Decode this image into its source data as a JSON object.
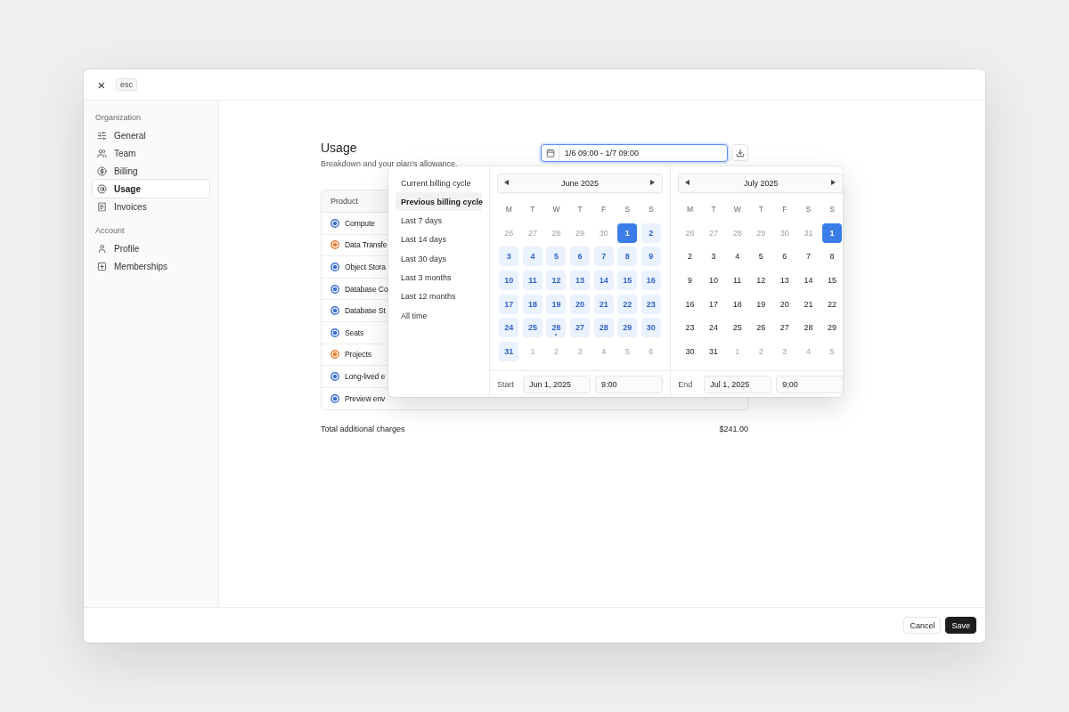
{
  "header": {
    "close": "×",
    "shortcut": "esc"
  },
  "sidebar": {
    "sections": [
      {
        "title": "Organization",
        "items": [
          {
            "label": "General",
            "selected": false
          },
          {
            "label": "Team",
            "selected": false
          },
          {
            "label": "Billing",
            "selected": false
          },
          {
            "label": "Usage",
            "selected": true
          },
          {
            "label": "Invoices",
            "selected": false
          }
        ]
      },
      {
        "title": "Account",
        "items": [
          {
            "label": "Profile",
            "selected": false
          },
          {
            "label": "Memberships",
            "selected": false
          }
        ]
      }
    ]
  },
  "usage": {
    "title": "Usage",
    "subtitle": "Breakdown and your plan’s allowance.",
    "date_range": "1/6 09:00 - 1/7 09:00",
    "table": {
      "columns": [
        "Product"
      ],
      "rows": [
        {
          "product": "Compute",
          "color": "#3b6fd8"
        },
        {
          "product": "Data Transfe",
          "color": "#ee7a2e"
        },
        {
          "product": "Object Stora",
          "color": "#3b6fd8"
        },
        {
          "product": "Database Co",
          "color": "#3b6fd8"
        },
        {
          "product": "Database St",
          "color": "#3b6fd8"
        },
        {
          "product": "Seats",
          "color": "#3b6fd8"
        },
        {
          "product": "Projects",
          "color": "#ee7a2e"
        },
        {
          "product": "Long-lived e",
          "color": "#3b6fd8"
        },
        {
          "product": "Preview env",
          "color": "#3b6fd8"
        }
      ]
    },
    "total": {
      "label": "Total additional charges",
      "value": "$241.00"
    }
  },
  "picker": {
    "presets": [
      {
        "label": "Current billing cycle",
        "selected": false
      },
      {
        "label": "Previous billing cycle",
        "selected": true
      },
      {
        "label": "Last 7 days",
        "selected": false
      },
      {
        "label": "Last 14 days",
        "selected": false
      },
      {
        "label": "Last 30 days",
        "selected": false
      },
      {
        "label": "Last 3 months",
        "selected": false
      },
      {
        "label": "Last 12 months",
        "selected": false
      },
      {
        "label": "All time",
        "selected": false
      }
    ],
    "months": [
      {
        "title": "June 2025",
        "weekdays": [
          "M",
          "T",
          "W",
          "T",
          "F",
          "S",
          "S"
        ],
        "days": [
          {
            "label": "26",
            "kind": "outside"
          },
          {
            "label": "27",
            "kind": "outside"
          },
          {
            "label": "28",
            "kind": "outside"
          },
          {
            "label": "29",
            "kind": "outside"
          },
          {
            "label": "30",
            "kind": "outside"
          },
          {
            "label": "1",
            "kind": "endpoint"
          },
          {
            "label": "2",
            "kind": "range"
          },
          {
            "label": "3",
            "kind": "range"
          },
          {
            "label": "4",
            "kind": "range"
          },
          {
            "label": "5",
            "kind": "range"
          },
          {
            "label": "6",
            "kind": "range"
          },
          {
            "label": "7",
            "kind": "range"
          },
          {
            "label": "8",
            "kind": "range"
          },
          {
            "label": "9",
            "kind": "range"
          },
          {
            "label": "10",
            "kind": "range"
          },
          {
            "label": "11",
            "kind": "range"
          },
          {
            "label": "12",
            "kind": "range"
          },
          {
            "label": "13",
            "kind": "range"
          },
          {
            "label": "14",
            "kind": "range"
          },
          {
            "label": "15",
            "kind": "range"
          },
          {
            "label": "16",
            "kind": "range"
          },
          {
            "label": "17",
            "kind": "range"
          },
          {
            "label": "18",
            "kind": "range"
          },
          {
            "label": "19",
            "kind": "range"
          },
          {
            "label": "20",
            "kind": "range"
          },
          {
            "label": "21",
            "kind": "range"
          },
          {
            "label": "22",
            "kind": "range"
          },
          {
            "label": "23",
            "kind": "range"
          },
          {
            "label": "24",
            "kind": "range"
          },
          {
            "label": "25",
            "kind": "range"
          },
          {
            "label": "26",
            "kind": "range-today"
          },
          {
            "label": "27",
            "kind": "range"
          },
          {
            "label": "28",
            "kind": "range"
          },
          {
            "label": "29",
            "kind": "range"
          },
          {
            "label": "30",
            "kind": "range"
          },
          {
            "label": "31",
            "kind": "range"
          },
          {
            "label": "1",
            "kind": "outside"
          },
          {
            "label": "2",
            "kind": "outside"
          },
          {
            "label": "3",
            "kind": "outside"
          },
          {
            "label": "4",
            "kind": "outside"
          },
          {
            "label": "5",
            "kind": "outside"
          },
          {
            "label": "6",
            "kind": "outside"
          }
        ]
      },
      {
        "title": "July 2025",
        "weekdays": [
          "M",
          "T",
          "W",
          "T",
          "F",
          "S",
          "S"
        ],
        "days": [
          {
            "label": "26",
            "kind": "outside"
          },
          {
            "label": "27",
            "kind": "outside"
          },
          {
            "label": "28",
            "kind": "outside"
          },
          {
            "label": "29",
            "kind": "outside"
          },
          {
            "label": "30",
            "kind": "outside"
          },
          {
            "label": "31",
            "kind": "outside"
          },
          {
            "label": "1",
            "kind": "endpoint"
          },
          {
            "label": "2",
            "kind": "plain"
          },
          {
            "label": "3",
            "kind": "plain"
          },
          {
            "label": "4",
            "kind": "plain"
          },
          {
            "label": "5",
            "kind": "plain"
          },
          {
            "label": "6",
            "kind": "plain"
          },
          {
            "label": "7",
            "kind": "plain"
          },
          {
            "label": "8",
            "kind": "plain"
          },
          {
            "label": "9",
            "kind": "plain"
          },
          {
            "label": "10",
            "kind": "plain"
          },
          {
            "label": "11",
            "kind": "plain"
          },
          {
            "label": "12",
            "kind": "plain"
          },
          {
            "label": "13",
            "kind": "plain"
          },
          {
            "label": "14",
            "kind": "plain"
          },
          {
            "label": "15",
            "kind": "plain"
          },
          {
            "label": "16",
            "kind": "plain"
          },
          {
            "label": "17",
            "kind": "plain"
          },
          {
            "label": "18",
            "kind": "plain"
          },
          {
            "label": "19",
            "kind": "plain"
          },
          {
            "label": "20",
            "kind": "plain"
          },
          {
            "label": "21",
            "kind": "plain"
          },
          {
            "label": "22",
            "kind": "plain"
          },
          {
            "label": "23",
            "kind": "plain"
          },
          {
            "label": "24",
            "kind": "plain"
          },
          {
            "label": "25",
            "kind": "plain"
          },
          {
            "label": "26",
            "kind": "plain"
          },
          {
            "label": "27",
            "kind": "plain"
          },
          {
            "label": "28",
            "kind": "plain"
          },
          {
            "label": "29",
            "kind": "plain"
          },
          {
            "label": "30",
            "kind": "plain"
          },
          {
            "label": "31",
            "kind": "plain"
          },
          {
            "label": "1",
            "kind": "outside"
          },
          {
            "label": "2",
            "kind": "outside"
          },
          {
            "label": "3",
            "kind": "outside"
          },
          {
            "label": "4",
            "kind": "outside"
          },
          {
            "label": "5",
            "kind": "outside"
          }
        ]
      }
    ],
    "start": {
      "label": "Start",
      "date": "Jun 1, 2025",
      "time": "9:00"
    },
    "end": {
      "label": "End",
      "date": "Jul 1, 2025",
      "time": "9:00"
    }
  },
  "footer": {
    "buttons": [
      {
        "label": "Cancel",
        "kind": "secondary"
      },
      {
        "label": "Save",
        "kind": "primary"
      }
    ]
  }
}
